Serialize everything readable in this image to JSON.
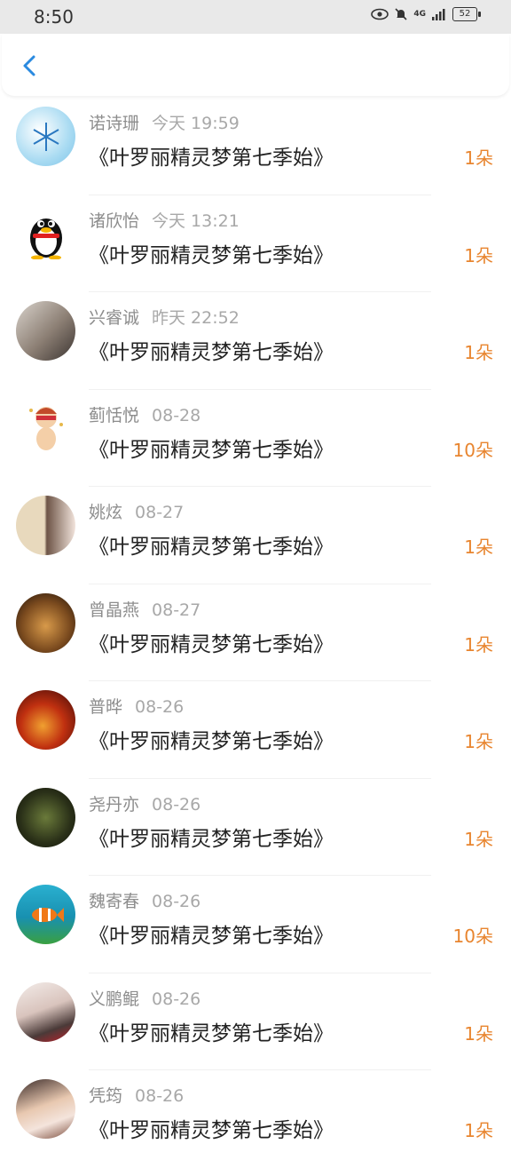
{
  "status_bar": {
    "time": "8:50",
    "network": "4G",
    "battery": "52"
  },
  "nav": {
    "back_icon": "chevron-left-icon"
  },
  "colors": {
    "accent": "#2a8ae0",
    "count": "#e8852f",
    "name": "#8d8d8d",
    "date": "#a8a8a8"
  },
  "items": [
    {
      "name": "诺诗珊",
      "date": "今天 19:59",
      "title": "《叶罗丽精灵梦第七季始》",
      "count": "1朵",
      "avatar": "snowflake-avatar"
    },
    {
      "name": "诸欣怡",
      "date": "今天 13:21",
      "title": "《叶罗丽精灵梦第七季始》",
      "count": "1朵",
      "avatar": "penguin-avatar"
    },
    {
      "name": "兴睿诚",
      "date": "昨天 22:52",
      "title": "《叶罗丽精灵梦第七季始》",
      "count": "1朵",
      "avatar": "anime-couple-avatar"
    },
    {
      "name": "蓟恬悦",
      "date": "08-28",
      "title": "《叶罗丽精灵梦第七季始》",
      "count": "10朵",
      "avatar": "cartoon-character-avatar"
    },
    {
      "name": "姚炫",
      "date": "08-27",
      "title": "《叶罗丽精灵梦第七季始》",
      "count": "1朵",
      "avatar": "girl-mask-avatar"
    },
    {
      "name": "曾晶燕",
      "date": "08-27",
      "title": "《叶罗丽精灵梦第七季始》",
      "count": "1朵",
      "avatar": "wolf-avatar"
    },
    {
      "name": "普晔",
      "date": "08-26",
      "title": "《叶罗丽精灵梦第七季始》",
      "count": "1朵",
      "avatar": "fire-figure-avatar"
    },
    {
      "name": "尧丹亦",
      "date": "08-26",
      "title": "《叶罗丽精灵梦第七季始》",
      "count": "1朵",
      "avatar": "plant-avatar"
    },
    {
      "name": "魏寄春",
      "date": "08-26",
      "title": "《叶罗丽精灵梦第七季始》",
      "count": "10朵",
      "avatar": "clownfish-avatar"
    },
    {
      "name": "义鹏鲲",
      "date": "08-26",
      "title": "《叶罗丽精灵梦第七季始》",
      "count": "1朵",
      "avatar": "portrait-avatar"
    },
    {
      "name": "凭筠",
      "date": "08-26",
      "title": "《叶罗丽精灵梦第七季始》",
      "count": "1朵",
      "avatar": "boy-portrait-avatar"
    }
  ]
}
